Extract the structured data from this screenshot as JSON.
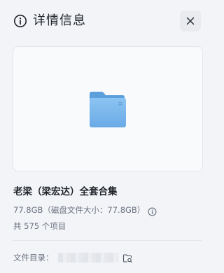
{
  "header": {
    "title": "详情信息",
    "title_icon": "info-circle-icon",
    "close_icon": "close-icon"
  },
  "preview": {
    "icon": "folder-icon",
    "folder_color": "#6aaee8"
  },
  "item": {
    "name": "老梁（梁宏达）全套合集",
    "size_text": "77.8GB（磁盘文件大小：77.8GB）",
    "size_info_icon": "info-circle-icon",
    "count_text": "共 575 个项目"
  },
  "directory": {
    "label": "文件目录：",
    "open_icon": "open-folder-icon"
  }
}
